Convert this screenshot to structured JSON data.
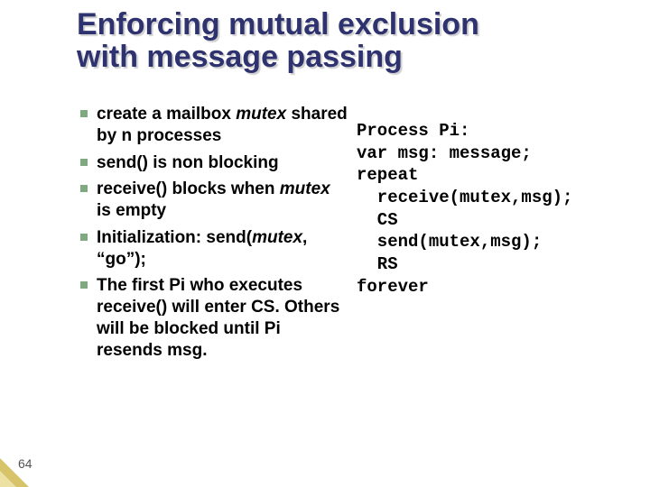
{
  "title_line1": "Enforcing mutual exclusion",
  "title_line2": "with message passing",
  "bullets": [
    {
      "pre": "create  a mailbox ",
      "em": "mutex",
      "post": " shared by n processes"
    },
    {
      "pre": "send() is non blocking",
      "em": "",
      "post": ""
    },
    {
      "pre": "receive() blocks when ",
      "em": "mutex",
      "post": " is empty"
    },
    {
      "pre": "Initialization: send(",
      "em": "mutex",
      "post": ", “go”);"
    },
    {
      "pre": "The first Pi who executes receive() will enter CS. Others will be blocked until Pi resends msg.",
      "em": "",
      "post": ""
    }
  ],
  "code": "Process Pi:\nvar msg: message;\nrepeat\n  receive(mutex,msg);\n  CS\n  send(mutex,msg);\n  RS\nforever",
  "slide_number": "64"
}
